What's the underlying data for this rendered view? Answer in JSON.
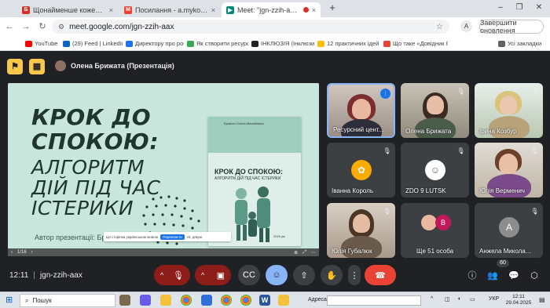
{
  "browser": {
    "tabs": [
      {
        "title": "Щонайменше кожен четвертий ш",
        "favicon": "Б",
        "color": "#d93025"
      },
      {
        "title": "Посилання - a.mykolaichuk@vipp",
        "favicon": "M",
        "color": "#ea4335"
      },
      {
        "title": "Meet: \"jgn-zzih-aax\"",
        "favicon": "▶",
        "color": "#00897b",
        "active": true
      }
    ],
    "new_tab": "+",
    "url": "meet.google.com/jgn-zzih-aax",
    "profile_letter": "A",
    "update_button": "Завершити оновлення",
    "bookmarks": [
      {
        "label": "YouTube",
        "color": "#ff0000"
      },
      {
        "label": "(29) Feed | LinkedIn",
        "color": "#0a66c2"
      },
      {
        "label": "Директору про робо...",
        "color": "#1a73e8"
      },
      {
        "label": "Як створити ресурсн...",
        "color": "#34a853"
      },
      {
        "label": "ІНКЛЮЗІЯ (Інклюзив...",
        "color": "#202124"
      },
      {
        "label": "12 практичних ідей з...",
        "color": "#fbbc04"
      },
      {
        "label": "Що таке «Довідник б...",
        "color": "#ea4335"
      },
      {
        "label": "Усі закладки",
        "color": "#5f6368"
      }
    ]
  },
  "meet": {
    "presenter": "Олена Брижата (Презентація)",
    "slide": {
      "title_lines": [
        "КРОК ДО",
        "СПОКОЮ:",
        "АЛГОРИТМ",
        "ДІЙ ПІД ЧАС",
        "ІСТЕРИКИ"
      ],
      "author": "Автор презентації: Бри",
      "book_author": "Бріжата Олена Михайлівна",
      "book_title_1": "КРОК ДО СПОКОЮ:",
      "book_title_2": "АЛГОРИТМ ДІЙ ПІД ЧАС ІСТЕРИКИ",
      "book_year": "2025 рік",
      "translate_text": "Ця сторінка українською мовою",
      "translate_button": "Перекласти",
      "translate_close": "Ні, дякую",
      "page_indicator": "1/16"
    },
    "participants": [
      {
        "name": "Ресурсний цент...",
        "type": "video",
        "speaking": true
      },
      {
        "name": "Олена Брижата",
        "type": "video"
      },
      {
        "name": "Ірина Козбур",
        "type": "video"
      },
      {
        "name": "Іванна Король",
        "type": "avatar",
        "avatar_color": "#f9ab00"
      },
      {
        "name": "ZDO 9 LUTSK",
        "type": "avatar",
        "avatar_color": "#ffffff"
      },
      {
        "name": "Юлія Верменич",
        "type": "video"
      },
      {
        "name": "Юлія Губалюк",
        "type": "video"
      },
      {
        "name": "Ще 51 особа",
        "type": "group",
        "letter": "В",
        "avatar_color": "#c2185b"
      },
      {
        "name": "Анжела Микола...",
        "type": "letter",
        "letter": "А",
        "avatar_color": "#8d8d8d"
      }
    ],
    "time": "12:11",
    "meeting_code": "jgn-zzih-aax",
    "people_count": "60"
  },
  "taskbar": {
    "search_placeholder": "Пошук",
    "address_label": "Адреса",
    "language": "УКР",
    "clock_time": "12:11",
    "clock_date": "29.04.2025"
  }
}
